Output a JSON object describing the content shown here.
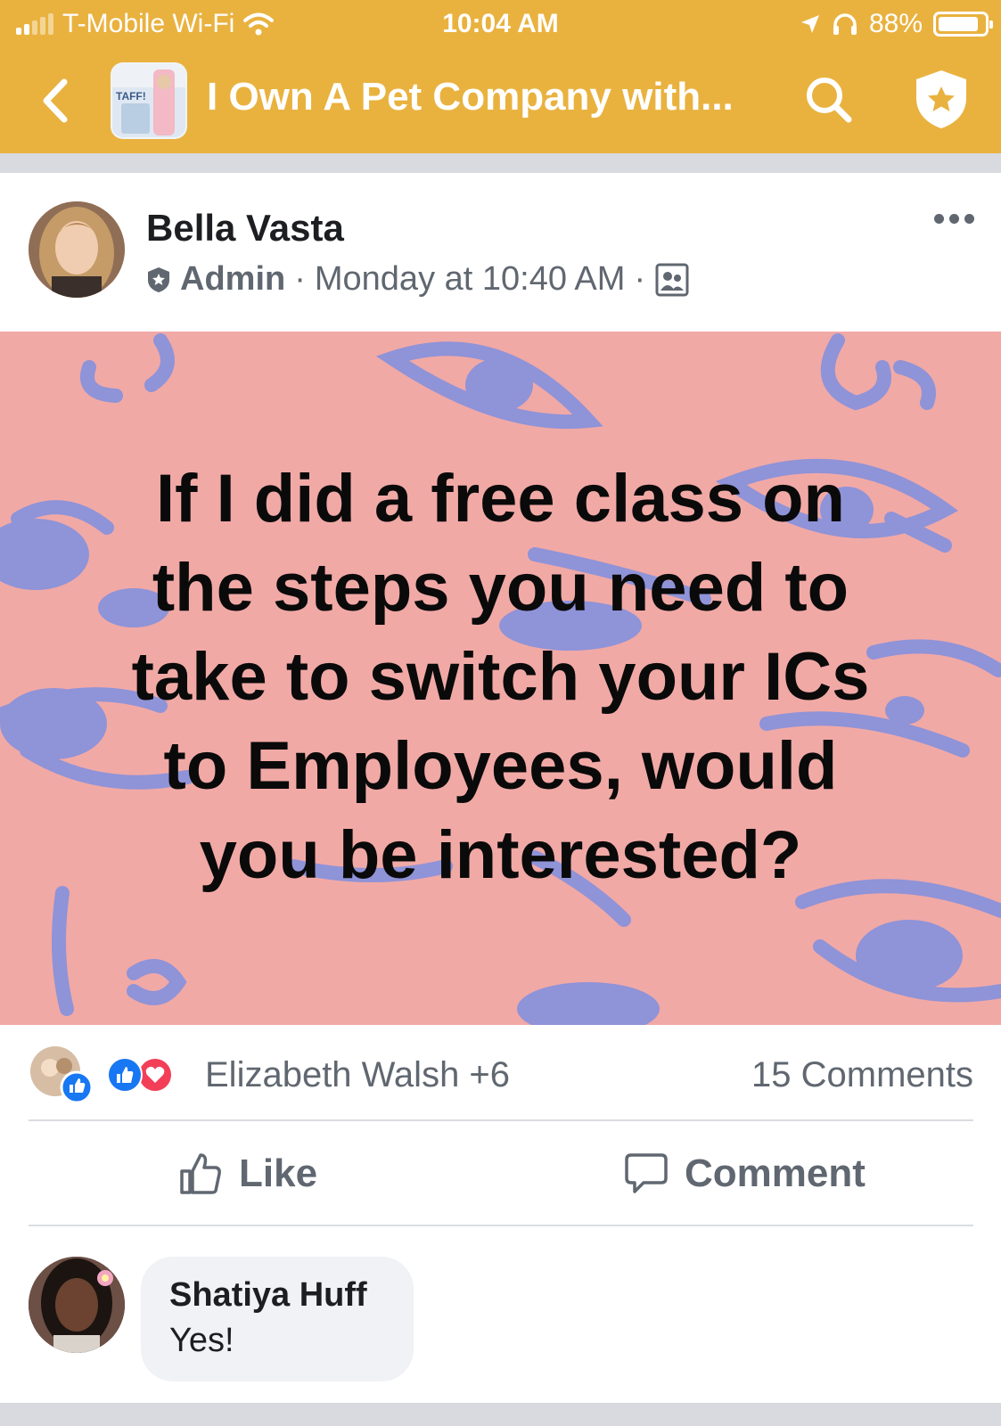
{
  "status_bar": {
    "carrier": "T-Mobile Wi-Fi",
    "time": "10:04 AM",
    "battery": "88%",
    "battery_level": 0.88
  },
  "nav": {
    "title": "I Own A Pet Company with...",
    "thumb_text": "TAFF!",
    "icons": [
      "back-icon",
      "search-icon",
      "admin-shield-icon"
    ]
  },
  "post": {
    "author": "Bella Vasta",
    "role": "Admin",
    "separator": "·",
    "timestamp": "Monday at 10:40 AM",
    "image_text": "If I did a free class on\nthe steps you need to\ntake to switch your ICs\nto Employees, would\nyou be interested?",
    "reactions": {
      "names": "Elizabeth Walsh +6",
      "comments": "15 Comments",
      "types": [
        "like",
        "love"
      ]
    },
    "actions": {
      "like": "Like",
      "comment": "Comment"
    }
  },
  "comment": {
    "author": "Shatiya Huff",
    "text": "Yes!"
  },
  "colors": {
    "nav_bg": "#e9b23f",
    "image_bg": "#f1a9a6",
    "pattern": "#8f93d8",
    "like_blue": "#1877f2",
    "love_red": "#f33e58"
  }
}
